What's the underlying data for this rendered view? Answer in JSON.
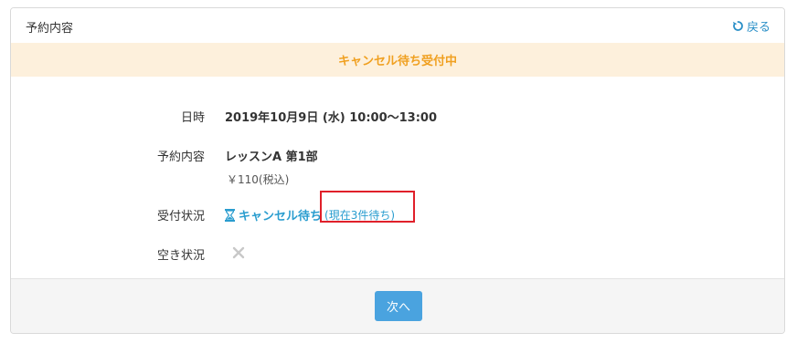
{
  "header": {
    "title": "予約内容",
    "back_label": "戻る"
  },
  "banner": {
    "text": "キャンセル待ち受付中"
  },
  "details": {
    "datetime": {
      "label": "日時",
      "value": "2019年10月9日 (水) 10:00〜13:00"
    },
    "reservation": {
      "label": "予約内容",
      "value": "レッスンA 第1部",
      "price": "￥110(税込)"
    },
    "reception_status": {
      "label": "受付状況",
      "value": "キャンセル待ち",
      "wait_count": "(現在3件待ち)"
    },
    "availability": {
      "label": "空き状況"
    }
  },
  "footer": {
    "next_label": "次へ"
  },
  "colors": {
    "accent_blue": "#2a9dcf",
    "banner_bg": "#fdf0dc",
    "banner_text": "#f0a020",
    "button_bg": "#4aa3df",
    "highlight_red": "#e0202a"
  },
  "icons": {
    "back": "undo-arrow-icon",
    "status": "hourglass-icon",
    "availability": "close-icon"
  }
}
